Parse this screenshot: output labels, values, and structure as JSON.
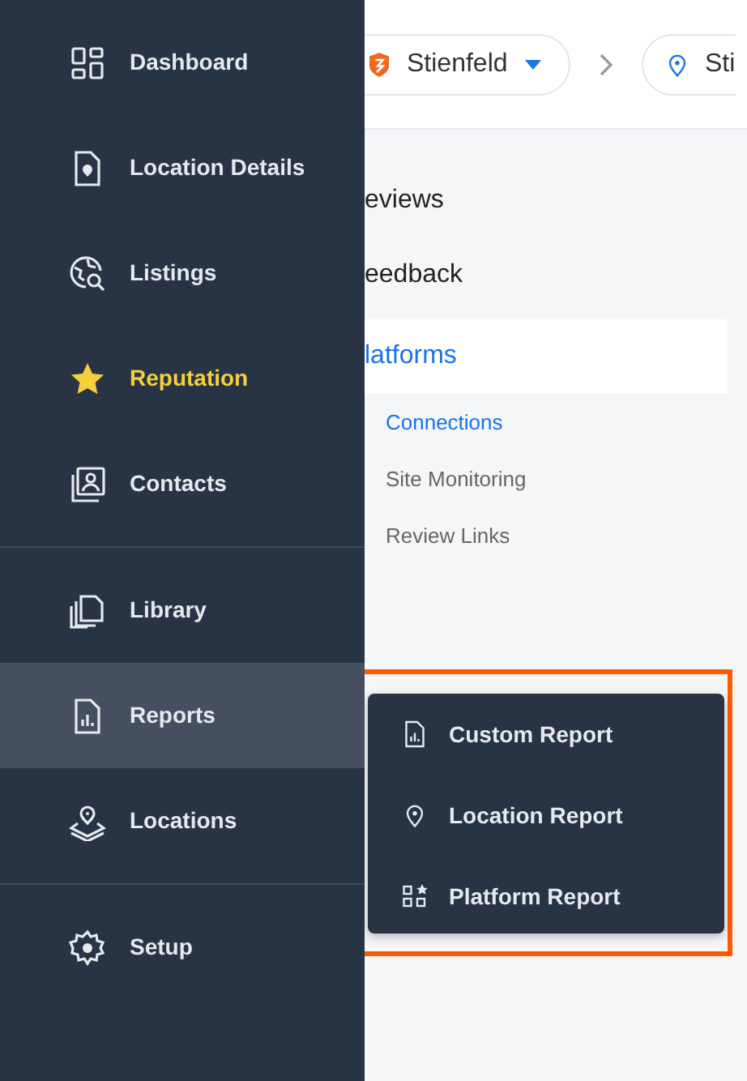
{
  "sidebar": {
    "groups": [
      {
        "items": [
          {
            "label": "Dashboard",
            "selected": false,
            "highlighted": false
          },
          {
            "label": "Location Details",
            "selected": false,
            "highlighted": false
          },
          {
            "label": "Listings",
            "selected": false,
            "highlighted": false
          },
          {
            "label": "Reputation",
            "selected": true,
            "highlighted": false
          },
          {
            "label": "Contacts",
            "selected": false,
            "highlighted": false
          }
        ]
      },
      {
        "items": [
          {
            "label": "Library",
            "selected": false,
            "highlighted": false
          },
          {
            "label": "Reports",
            "selected": false,
            "highlighted": true
          },
          {
            "label": "Locations",
            "selected": false,
            "highlighted": false
          }
        ]
      },
      {
        "items": [
          {
            "label": "Setup",
            "selected": false,
            "highlighted": false
          }
        ]
      }
    ]
  },
  "breadcrumb": [
    {
      "label": "Stienfeld",
      "dropdown": true
    },
    {
      "label": "Sti",
      "dropdown": false
    }
  ],
  "section_nav": [
    {
      "label": "eviews",
      "selected": false
    },
    {
      "label": "eedback",
      "selected": false
    },
    {
      "label": "latforms",
      "selected": true,
      "children": [
        {
          "label": "Connections",
          "selected": true
        },
        {
          "label": "Site Monitoring",
          "selected": false
        },
        {
          "label": "Review Links",
          "selected": false
        }
      ]
    }
  ],
  "reports_menu": {
    "highlighted": true,
    "items": [
      {
        "label": "Custom Report"
      },
      {
        "label": "Location Report"
      },
      {
        "label": "Platform Report"
      }
    ]
  }
}
